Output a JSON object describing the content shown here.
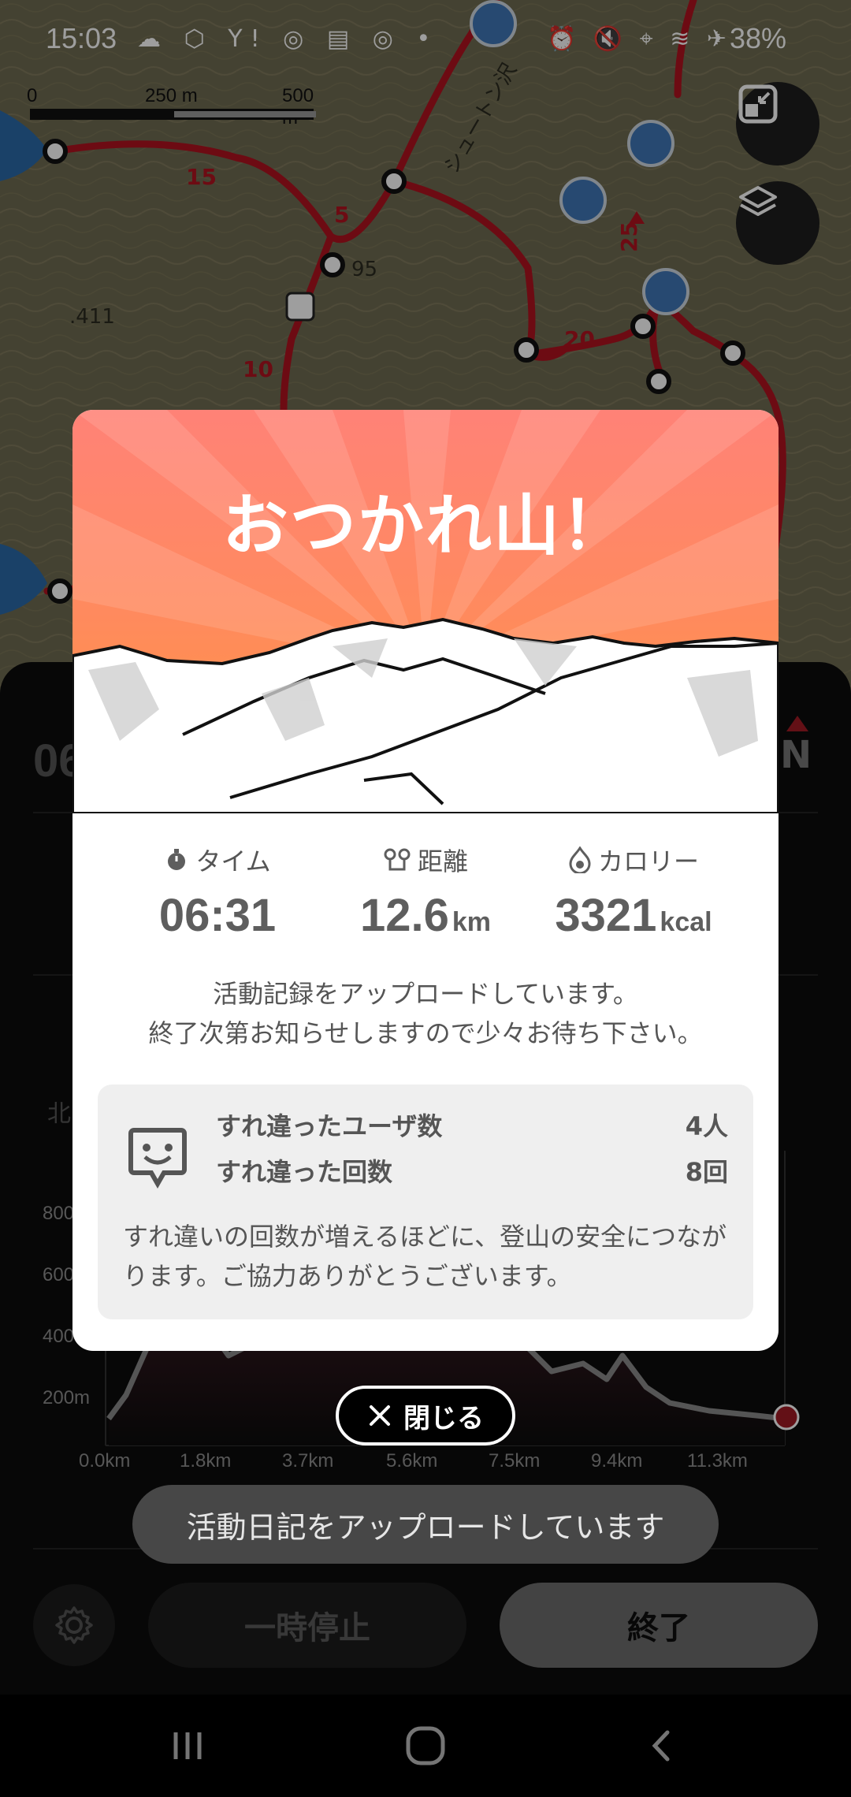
{
  "status_bar": {
    "time": "15:03",
    "battery": "38%",
    "left_icons": [
      "weather-icon",
      "box-icon",
      "yahoo-icon",
      "chrome-icon",
      "news-icon",
      "chrome-icon",
      "dot-icon"
    ],
    "right_icons": [
      "alarm-icon",
      "mute-icon",
      "location-icon",
      "wifi-icon",
      "airplane-icon",
      "battery-icon"
    ]
  },
  "map": {
    "scale_labels": [
      "0",
      "250 m",
      "500 m"
    ],
    "trail_numbers": [
      "15",
      "5",
      "95",
      "10",
      "20",
      "25",
      "411"
    ],
    "place_label": "シュートン沢"
  },
  "panel": {
    "elapsed_partial": "06",
    "compass": "N",
    "north_label": "北",
    "chart_y_ticks": [
      "800",
      "600",
      "400",
      "200m"
    ],
    "chart_x_ticks": [
      "0.0km",
      "1.8km",
      "3.7km",
      "5.6km",
      "7.5km",
      "9.4km",
      "11.3km"
    ]
  },
  "modal": {
    "title": "おつかれ山！",
    "stats": [
      {
        "label": "タイム",
        "value": "06:31",
        "unit": ""
      },
      {
        "label": "距離",
        "value": "12.6",
        "unit": "km"
      },
      {
        "label": "カロリー",
        "value": "3321",
        "unit": "kcal"
      }
    ],
    "upload_line1": "活動記録をアップロードしています。",
    "upload_line2": "終了次第お知らせしますので少々お待ち下さい。",
    "encounter": {
      "users_label": "すれ違ったユーザ数",
      "users_value": "4人",
      "count_label": "すれ違った回数",
      "count_value": "8回",
      "note": "すれ違いの回数が増えるほどに、登山の安全につながります。ご協力ありがとうございます。"
    }
  },
  "close_label": "閉じる",
  "toast": "活動日記をアップロードしています",
  "buttons": {
    "pause": "一時停止",
    "end": "終了"
  },
  "colors": {
    "trail": "#b0131f",
    "hero_top": "#ff8277",
    "hero_bottom": "#ff963c",
    "chart_line": "#8a8a8a",
    "current_marker": "#a01a25"
  }
}
